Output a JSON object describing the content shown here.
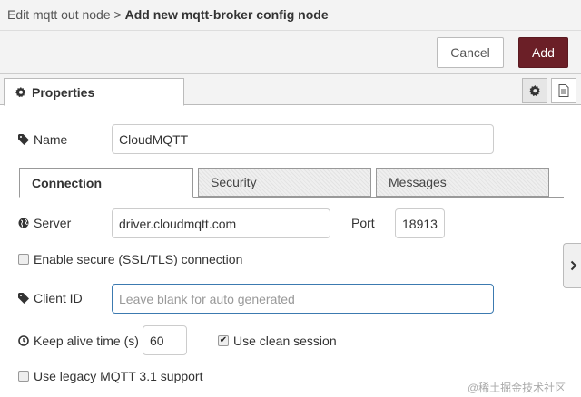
{
  "breadcrumb": {
    "parent": "Edit mqtt out node",
    "separator": ">",
    "current": "Add new mqtt-broker config node"
  },
  "toolbar": {
    "cancel_label": "Cancel",
    "add_label": "Add",
    "add_color": "#6b1f27"
  },
  "panel_tabs": {
    "properties_label": "Properties",
    "settings_icon": "gear-icon",
    "description_icon": "document-icon"
  },
  "form": {
    "name": {
      "label": "Name",
      "value": "CloudMQTT",
      "icon": "tag-icon"
    },
    "config_tabs": [
      {
        "label": "Connection",
        "active": true
      },
      {
        "label": "Security",
        "active": false
      },
      {
        "label": "Messages",
        "active": false
      }
    ],
    "server": {
      "label": "Server",
      "value": "driver.cloudmqtt.com",
      "icon": "globe-icon"
    },
    "port": {
      "label": "Port",
      "value": "18913"
    },
    "tls": {
      "label": "Enable secure (SSL/TLS) connection",
      "checked": false
    },
    "client_id": {
      "label": "Client ID",
      "value": "",
      "placeholder": "Leave blank for auto generated",
      "icon": "tag-icon"
    },
    "keepalive": {
      "label": "Keep alive time (s)",
      "value": "60",
      "icon": "clock-icon"
    },
    "clean_session": {
      "label": "Use clean session",
      "checked": true
    },
    "legacy": {
      "label": "Use legacy MQTT 3.1 support",
      "checked": false
    }
  },
  "side_handle_icon": "chevron-right-icon",
  "watermark": "@稀土掘金技术社区"
}
